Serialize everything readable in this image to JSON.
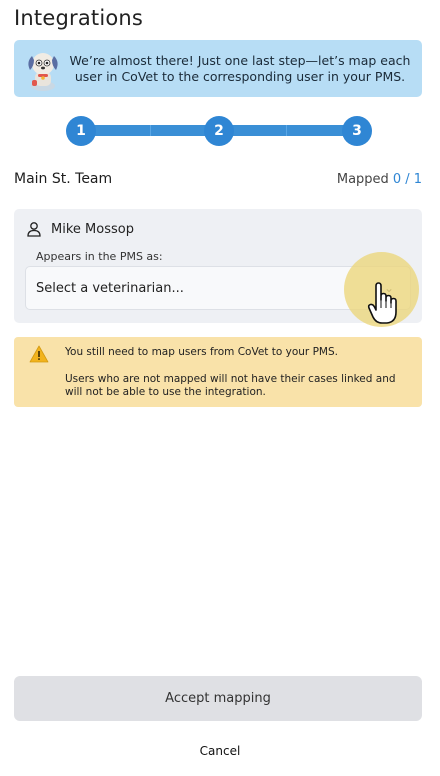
{
  "page": {
    "title": "Integrations"
  },
  "banner": {
    "message": "We’re almost there! Just one last step—let’s map each user in CoVet to the corresponding user in your PMS."
  },
  "stepper": {
    "steps": [
      "1",
      "2",
      "3"
    ],
    "active_color": "#2f86d4"
  },
  "team": {
    "name": "Main St. Team",
    "mapped_label": "Mapped",
    "mapped_count": "0 / 1"
  },
  "user": {
    "name": "Mike Mossop",
    "appears_label": "Appears in the PMS as:",
    "select_placeholder": "Select a veterinarian...",
    "icon": "user-icon"
  },
  "warning": {
    "line1": "You still need to map users from CoVet to your PMS.",
    "line2": "Users who are not mapped will not have their cases linked and will not be able to use the integration.",
    "icon": "warning-icon"
  },
  "actions": {
    "accept_label": "Accept mapping",
    "cancel_label": "Cancel"
  }
}
